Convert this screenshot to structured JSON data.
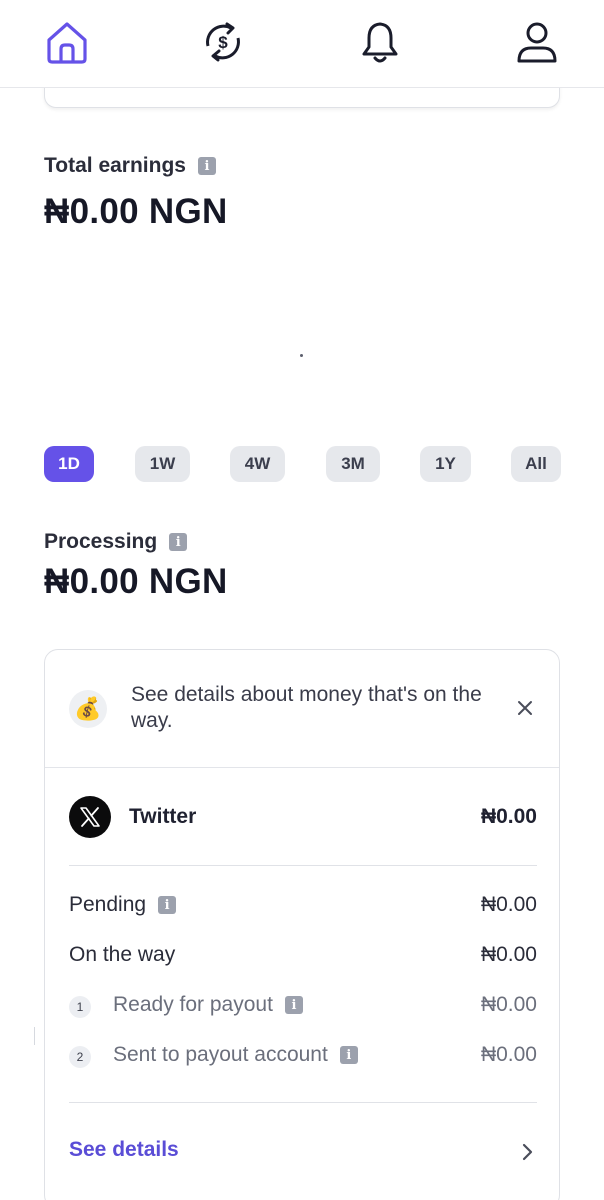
{
  "nav": {
    "items": [
      {
        "name": "home",
        "active": true
      },
      {
        "name": "payments"
      },
      {
        "name": "notifications"
      },
      {
        "name": "profile"
      }
    ],
    "active_color": "#6552e8"
  },
  "total_earnings": {
    "label": "Total earnings",
    "amount": "₦0.00 NGN"
  },
  "ranges": {
    "items": [
      "1D",
      "1W",
      "4W",
      "3M",
      "1Y",
      "All"
    ],
    "selected": "1D"
  },
  "processing": {
    "label": "Processing",
    "amount": "₦0.00 NGN"
  },
  "card": {
    "banner_text": "See details about money that's on the way.",
    "source": {
      "name": "Twitter",
      "amount": "₦0.00"
    },
    "pending": {
      "label": "Pending",
      "amount": "₦0.00"
    },
    "on_the_way": {
      "label": "On the way",
      "amount": "₦0.00"
    },
    "steps": [
      {
        "number": "1",
        "label": "Ready for payout",
        "amount": "₦0.00"
      },
      {
        "number": "2",
        "label": "Sent to payout account",
        "amount": "₦0.00"
      }
    ],
    "see_details": "See details"
  }
}
